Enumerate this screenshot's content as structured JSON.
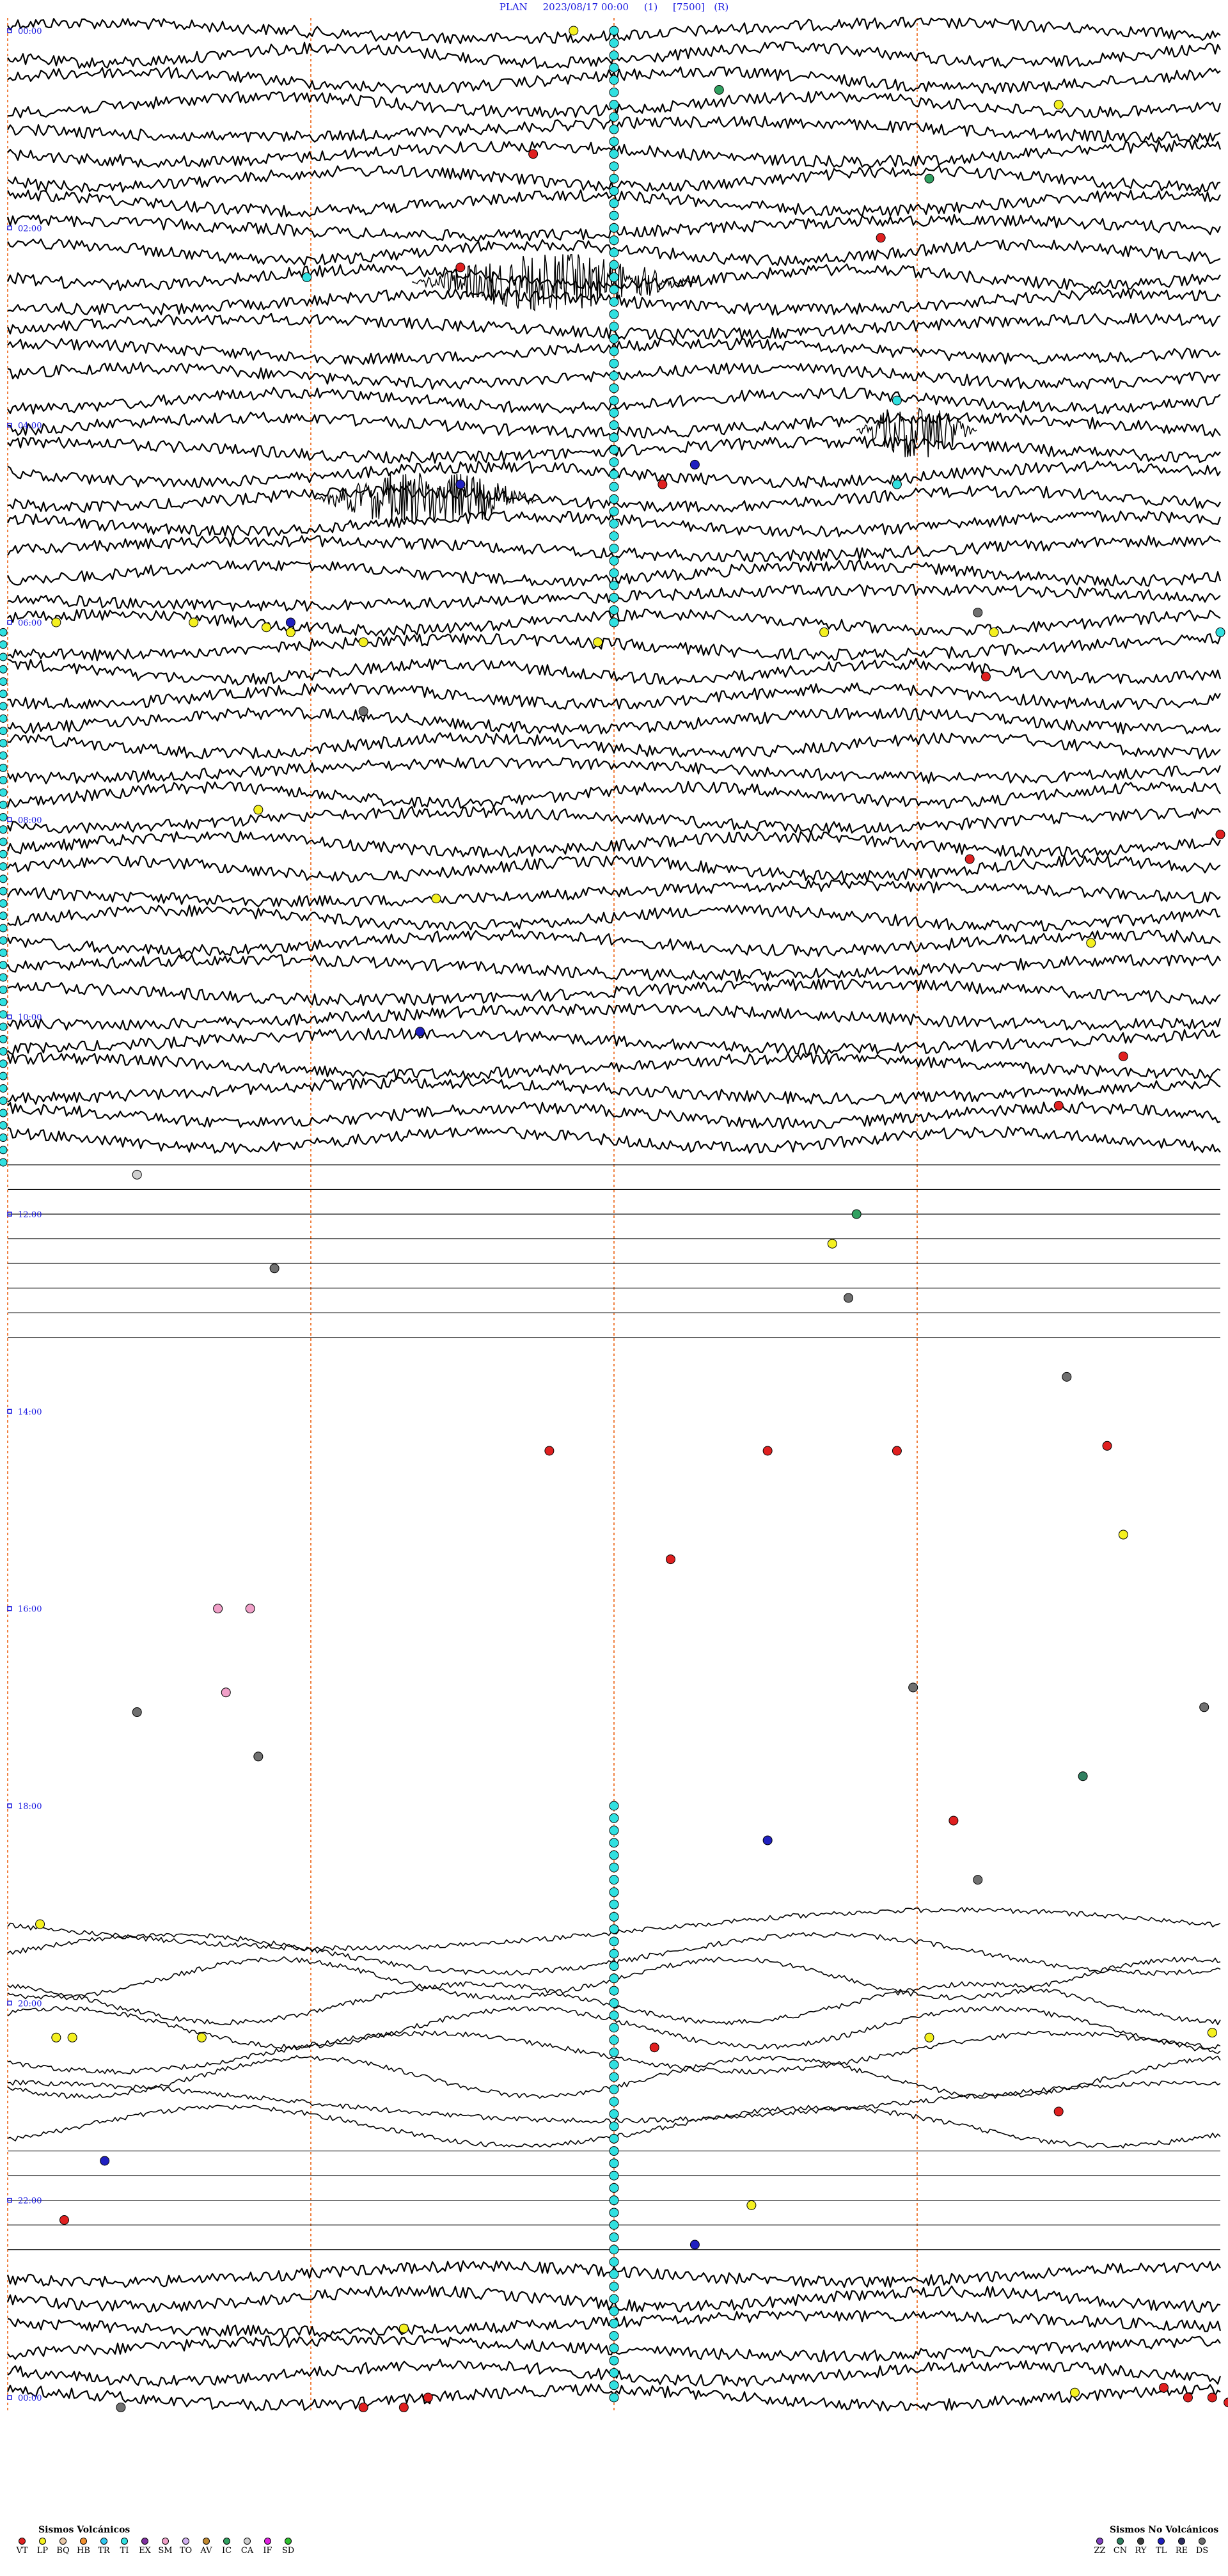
{
  "title": {
    "station": "PLAN",
    "datetime": "2023/08/17 00:00",
    "channel": "(1)",
    "scale": "[7500]",
    "flag": "(R)"
  },
  "chart_data": {
    "type": "helicorder",
    "x_minutes_per_line": 15,
    "lines_per_hour": 4,
    "hours": 24,
    "hour_labels": [
      {
        "hour": 0,
        "label": "00:00"
      },
      {
        "hour": 2,
        "label": "02:00"
      },
      {
        "hour": 4,
        "label": "04:00"
      },
      {
        "hour": 6,
        "label": "06:00"
      },
      {
        "hour": 8,
        "label": "08:00"
      },
      {
        "hour": 10,
        "label": "10:00"
      },
      {
        "hour": 12,
        "label": "12:00"
      },
      {
        "hour": 14,
        "label": "14:00"
      },
      {
        "hour": 16,
        "label": "16:00"
      },
      {
        "hour": 18,
        "label": "18:00"
      },
      {
        "hour": 20,
        "label": "20:00"
      },
      {
        "hour": 22,
        "label": "22:00"
      },
      {
        "hour": 24,
        "label": "00:00"
      }
    ],
    "minute_markers": [
      3.75,
      7.5,
      11.25
    ],
    "trace_activity": [
      {
        "from_hour": 0,
        "to_hour": 11.4,
        "level": "high"
      },
      {
        "from_hour": 11.4,
        "to_hour": 13.4,
        "level": "flat"
      },
      {
        "from_hour": 13.4,
        "to_hour": 19.2,
        "level": "none"
      },
      {
        "from_hour": 19.2,
        "to_hour": 21.4,
        "level": "glitch"
      },
      {
        "from_hour": 21.4,
        "to_hour": 22.6,
        "level": "flat"
      },
      {
        "from_hour": 22.6,
        "to_hour": 24,
        "level": "high"
      }
    ],
    "bursts": [
      {
        "hour": 2.55,
        "minute": 5.0,
        "width_min": 3.5,
        "label": "burst-1"
      },
      {
        "hour": 4.75,
        "minute": 3.8,
        "width_min": 2.8,
        "label": "burst-2"
      },
      {
        "hour": 4.05,
        "minute": 10.5,
        "width_min": 1.5,
        "label": "burst-3"
      }
    ],
    "events": [
      {
        "hour": 0.0,
        "minute": 7.0,
        "type": "LP"
      },
      {
        "hour": 0.75,
        "minute": 13.0,
        "type": "LP"
      },
      {
        "hour": 0.6,
        "minute": 8.8,
        "type": "IC"
      },
      {
        "hour": 1.25,
        "minute": 6.5,
        "type": "VT"
      },
      {
        "hour": 1.5,
        "minute": 11.4,
        "type": "IC"
      },
      {
        "hour": 2.1,
        "minute": 10.8,
        "type": "VT"
      },
      {
        "hour": 2.4,
        "minute": 5.6,
        "type": "VT"
      },
      {
        "hour": 2.5,
        "minute": 3.7,
        "type": "TI"
      },
      {
        "hour": 3.75,
        "minute": 11.0,
        "type": "TI"
      },
      {
        "hour": 4.4,
        "minute": 8.5,
        "type": "TL"
      },
      {
        "hour": 4.6,
        "minute": 8.1,
        "type": "VT"
      },
      {
        "hour": 4.6,
        "minute": 5.6,
        "type": "TL"
      },
      {
        "hour": 4.6,
        "minute": 11.0,
        "type": "TI"
      },
      {
        "hour": 5.9,
        "minute": 12.0,
        "type": "DS"
      },
      {
        "hour": 6.0,
        "minute": 0.6,
        "type": "LP"
      },
      {
        "hour": 6.0,
        "minute": 2.3,
        "type": "LP"
      },
      {
        "hour": 6.05,
        "minute": 3.2,
        "type": "LP"
      },
      {
        "hour": 6.1,
        "minute": 3.5,
        "type": "LP"
      },
      {
        "hour": 6.2,
        "minute": 4.4,
        "type": "LP"
      },
      {
        "hour": 6.2,
        "minute": 7.3,
        "type": "LP"
      },
      {
        "hour": 6.1,
        "minute": 10.1,
        "type": "LP"
      },
      {
        "hour": 6.1,
        "minute": 12.2,
        "type": "LP"
      },
      {
        "hour": 6.1,
        "minute": 15.0,
        "type": "TI"
      },
      {
        "hour": 6.0,
        "minute": 3.5,
        "type": "TL"
      },
      {
        "hour": 6.55,
        "minute": 12.1,
        "type": "VT"
      },
      {
        "hour": 6.9,
        "minute": 4.4,
        "type": "DS"
      },
      {
        "hour": 7.9,
        "minute": 3.1,
        "type": "LP"
      },
      {
        "hour": 8.15,
        "minute": 15.0,
        "type": "VT"
      },
      {
        "hour": 8.4,
        "minute": 11.9,
        "type": "VT"
      },
      {
        "hour": 8.8,
        "minute": 5.3,
        "type": "LP"
      },
      {
        "hour": 9.25,
        "minute": 13.4,
        "type": "LP"
      },
      {
        "hour": 10.15,
        "minute": 5.1,
        "type": "TL"
      },
      {
        "hour": 10.4,
        "minute": 13.8,
        "type": "VT"
      },
      {
        "hour": 10.9,
        "minute": 13.0,
        "type": "VT"
      },
      {
        "hour": 11.6,
        "minute": 1.6,
        "type": "CA"
      },
      {
        "hour": 12.0,
        "minute": 10.5,
        "type": "IC"
      },
      {
        "hour": 12.3,
        "minute": 10.2,
        "type": "LP"
      },
      {
        "hour": 12.55,
        "minute": 3.3,
        "type": "DS"
      },
      {
        "hour": 12.85,
        "minute": 10.4,
        "type": "DS"
      },
      {
        "hour": 13.65,
        "minute": 13.1,
        "type": "DS"
      },
      {
        "hour": 14.4,
        "minute": 6.7,
        "type": "VT"
      },
      {
        "hour": 14.4,
        "minute": 9.4,
        "type": "VT"
      },
      {
        "hour": 14.4,
        "minute": 11.0,
        "type": "VT"
      },
      {
        "hour": 14.35,
        "minute": 13.6,
        "type": "VT"
      },
      {
        "hour": 15.5,
        "minute": 8.2,
        "type": "VT"
      },
      {
        "hour": 15.25,
        "minute": 13.8,
        "type": "LP"
      },
      {
        "hour": 16.0,
        "minute": 2.6,
        "type": "SM"
      },
      {
        "hour": 16.0,
        "minute": 3.0,
        "type": "SM"
      },
      {
        "hour": 16.85,
        "minute": 2.7,
        "type": "SM"
      },
      {
        "hour": 16.8,
        "minute": 11.2,
        "type": "DS"
      },
      {
        "hour": 17.05,
        "minute": 1.6,
        "type": "DS"
      },
      {
        "hour": 17.5,
        "minute": 3.1,
        "type": "DS"
      },
      {
        "hour": 17.0,
        "minute": 14.8,
        "type": "DS"
      },
      {
        "hour": 17.7,
        "minute": 13.3,
        "type": "CN"
      },
      {
        "hour": 18.15,
        "minute": 11.7,
        "type": "VT"
      },
      {
        "hour": 18.35,
        "minute": 9.4,
        "type": "TL"
      },
      {
        "hour": 18.75,
        "minute": 12.0,
        "type": "DS"
      },
      {
        "hour": 19.2,
        "minute": 0.4,
        "type": "LP"
      },
      {
        "hour": 20.35,
        "minute": 0.6,
        "type": "LP"
      },
      {
        "hour": 20.35,
        "minute": 0.8,
        "type": "LP"
      },
      {
        "hour": 20.35,
        "minute": 2.4,
        "type": "LP"
      },
      {
        "hour": 20.35,
        "minute": 11.4,
        "type": "LP"
      },
      {
        "hour": 20.45,
        "minute": 8.0,
        "type": "VT"
      },
      {
        "hour": 20.3,
        "minute": 14.9,
        "type": "LP"
      },
      {
        "hour": 21.1,
        "minute": 13.0,
        "type": "VT"
      },
      {
        "hour": 21.6,
        "minute": 1.2,
        "type": "TL"
      },
      {
        "hour": 22.05,
        "minute": 9.2,
        "type": "LP"
      },
      {
        "hour": 22.2,
        "minute": 0.7,
        "type": "VT"
      },
      {
        "hour": 22.45,
        "minute": 8.5,
        "type": "TL"
      },
      {
        "hour": 23.3,
        "minute": 4.9,
        "type": "LP"
      },
      {
        "hour": 23.9,
        "minute": 14.3,
        "type": "VT"
      },
      {
        "hour": 23.95,
        "minute": 13.2,
        "type": "LP"
      },
      {
        "hour": 24.0,
        "minute": 14.6,
        "type": "VT"
      },
      {
        "hour": 24.0,
        "minute": 14.9,
        "type": "VT"
      },
      {
        "hour": 24.05,
        "minute": 15.1,
        "type": "VT"
      },
      {
        "hour": 24.0,
        "minute": 16.0,
        "type": "TL"
      },
      {
        "hour": 24.1,
        "minute": 4.4,
        "type": "VT"
      },
      {
        "hour": 24.1,
        "minute": 4.9,
        "type": "VT"
      },
      {
        "hour": 24.0,
        "minute": 5.2,
        "type": "VT"
      },
      {
        "hour": 24.1,
        "minute": 1.4,
        "type": "DS"
      }
    ]
  },
  "markers_column": {
    "hour_from": 0,
    "hour_to": 6.1,
    "minute": 7.5,
    "type": "TI"
  },
  "markers_column_2": {
    "hour_from": 18.0,
    "hour_to": 24.1,
    "minute": 7.5,
    "type": "TI"
  },
  "markers_column_3": {
    "hour_from": 6.1,
    "hour_to": 11.5,
    "minute": 0.0,
    "type": "TI"
  },
  "legend_volcanic": {
    "heading": "Sismos Volcánicos",
    "items": [
      {
        "code": "VT",
        "color": "#e02020"
      },
      {
        "code": "LP",
        "color": "#f4f020"
      },
      {
        "code": "BQ",
        "color": "#e8c8a8"
      },
      {
        "code": "HB",
        "color": "#f09030"
      },
      {
        "code": "TR",
        "color": "#30c8f0"
      },
      {
        "code": "TI",
        "color": "#30e0e0"
      },
      {
        "code": "EX",
        "color": "#8030a0"
      },
      {
        "code": "SM",
        "color": "#f0a0c8"
      },
      {
        "code": "TO",
        "color": "#d0b0f0"
      },
      {
        "code": "AV",
        "color": "#c08830"
      },
      {
        "code": "IC",
        "color": "#30a060"
      },
      {
        "code": "CA",
        "color": "#d0d0d0"
      },
      {
        "code": "IF",
        "color": "#e020e0"
      },
      {
        "code": "SD",
        "color": "#30c030"
      }
    ]
  },
  "legend_nonvolcanic": {
    "heading": "Sismos No Volcánicos",
    "items": [
      {
        "code": "ZZ",
        "color": "#8040c0"
      },
      {
        "code": "CN",
        "color": "#308060"
      },
      {
        "code": "RY",
        "color": "#404040"
      },
      {
        "code": "TL",
        "color": "#2020c0"
      },
      {
        "code": "RE",
        "color": "#303060"
      },
      {
        "code": "DS",
        "color": "#707070"
      }
    ]
  }
}
